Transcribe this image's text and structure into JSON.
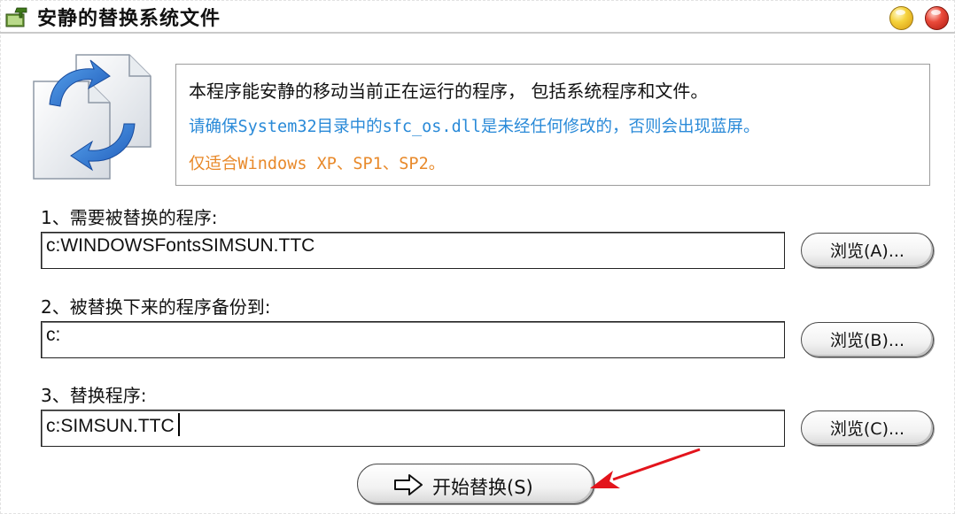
{
  "window": {
    "title": "安静的替换系统文件"
  },
  "info": {
    "line1": "本程序能安静的移动当前正在运行的程序， 包括系统程序和文件。",
    "line2": "请确保System32目录中的sfc_os.dll是未经任何修改的，否则会出现蓝屏。",
    "line3": "仅适合Windows XP、SP1、SP2。"
  },
  "colors": {
    "line2": "#2a8ad8",
    "line3": "#e8892a",
    "annotation_arrow": "#e3141c"
  },
  "sections": [
    {
      "label": "1、需要被替换的程序:",
      "value": "c:WINDOWSFontsSIMSUN.TTC",
      "browse_label": "浏览(A)..."
    },
    {
      "label": "2、被替换下来的程序备份到:",
      "value": "c:",
      "browse_label": "浏览(B)..."
    },
    {
      "label": "3、替换程序:",
      "value": "c:SIMSUN.TTC",
      "browse_label": "浏览(C)..."
    }
  ],
  "start_button": {
    "label": "开始替换(S)"
  },
  "icons": {
    "app": "install-icon",
    "files": "file-replace-icon",
    "start": "right-arrow-icon",
    "annotation": "red-pointer-arrow-icon"
  }
}
